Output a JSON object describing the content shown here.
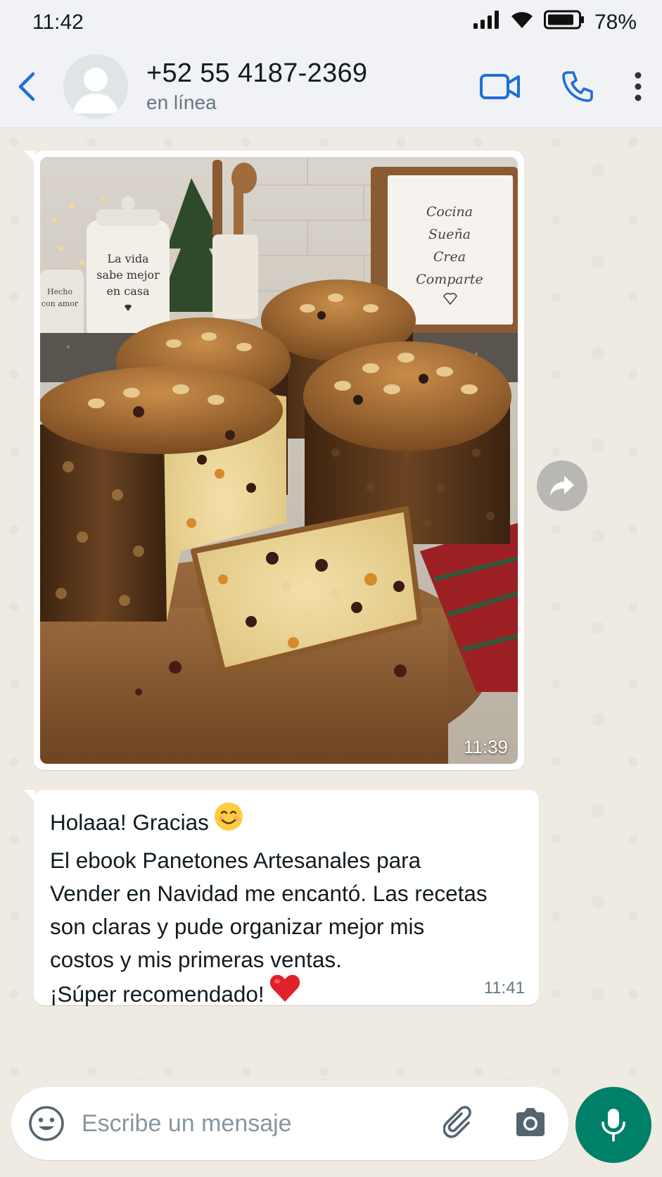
{
  "status_bar": {
    "time": "11:42",
    "battery": "78%",
    "icons": [
      "signal-icon",
      "wifi-icon",
      "battery-icon"
    ]
  },
  "header": {
    "contact_name": "+52 55 4187-2369",
    "contact_status": "en línea",
    "icons": [
      "back-arrow-icon",
      "avatar-icon",
      "video-call-icon",
      "phone-icon",
      "more-options-icon"
    ]
  },
  "messages": [
    {
      "type": "image",
      "time": "11:39",
      "photo_text": {
        "jar_label": [
          "La vida",
          "sabe mejor",
          "en casa"
        ],
        "small_jar_label": [
          "Hecho",
          "con amor"
        ],
        "sign": [
          "Cocina",
          "Sueña",
          "Crea",
          "Comparte"
        ]
      }
    },
    {
      "type": "text",
      "lines": [
        "Holaaa! Gracias",
        "El ebook Panetones Artesanales para",
        "Vender en Navidad me encantó. Las recetas",
        "son claras y pude organizar mejor mis",
        "costos y mis primeras ventas.",
        "¡Súper recomendado!"
      ],
      "emojis": [
        "smiling-face-emoji",
        "red-heart-emoji"
      ],
      "time": "11:41"
    }
  ],
  "input": {
    "placeholder": "Escribe un mensaje",
    "value": ""
  },
  "colors": {
    "accent": "#008069",
    "icon_blue": "#1f6fd6",
    "chat_bg": "#efeae2",
    "bubble": "#ffffff"
  }
}
